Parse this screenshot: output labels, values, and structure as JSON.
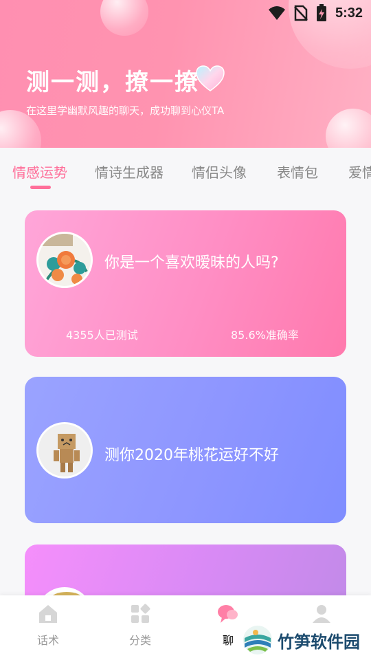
{
  "status_bar": {
    "time": "5:32",
    "icons": [
      "wifi-icon",
      "no-sim-icon",
      "battery-charging-icon"
    ]
  },
  "hero": {
    "title": "测一测，撩一撩",
    "subtitle": "在这里学幽默风趣的聊天，成功聊到心仪TA",
    "heart_icon": "heart-icon"
  },
  "tabs": [
    {
      "label": "情感运势",
      "active": true
    },
    {
      "label": "情诗生成器",
      "active": false
    },
    {
      "label": "情侣头像",
      "active": false
    },
    {
      "label": "表情包",
      "active": false
    },
    {
      "label": "爱情",
      "active": false
    }
  ],
  "cards": [
    {
      "title": "你是一个喜欢暧昧的人吗?",
      "stat_left": "4355人已测试",
      "stat_right": "85.6%准确率",
      "avatar": "embroidery-flower-avatar"
    },
    {
      "title": "测你2020年桃花运好不好",
      "avatar": "cardboard-robot-avatar"
    },
    {
      "title": "",
      "avatar": "third-card-avatar"
    }
  ],
  "bottom_nav": [
    {
      "label": "话术",
      "icon": "home-icon",
      "active": false
    },
    {
      "label": "分类",
      "icon": "grid-icon",
      "active": false
    },
    {
      "label": "聊",
      "icon": "chat-bubble-icon",
      "active": true
    },
    {
      "label": "",
      "icon": "user-icon",
      "active": false
    }
  ],
  "watermark": {
    "text": "竹笋软件园",
    "icon": "bamboo-logo-icon"
  },
  "colors": {
    "accent": "#ff6f9a",
    "card1": "#ff8ec4",
    "card2": "#8e96ff",
    "card3": "#d88af5"
  }
}
